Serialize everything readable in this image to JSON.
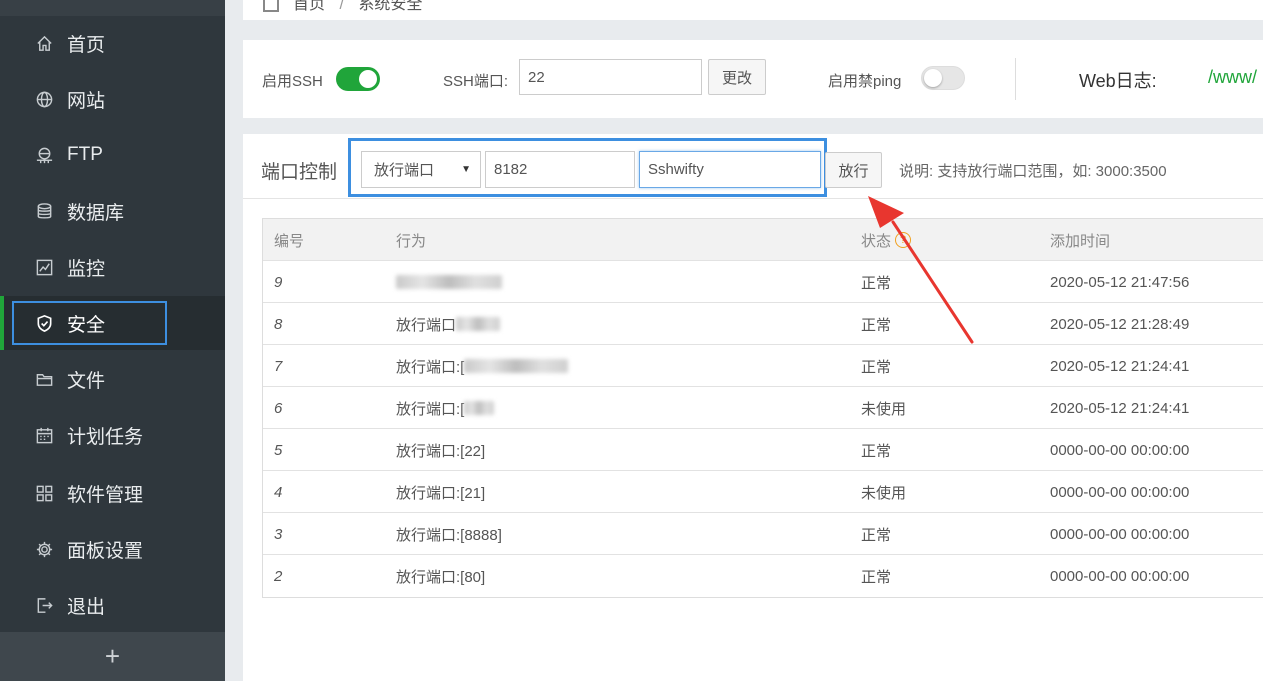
{
  "sidebar": {
    "items": [
      {
        "label": "首页",
        "icon": "home-icon"
      },
      {
        "label": "网站",
        "icon": "globe-icon"
      },
      {
        "label": "FTP",
        "icon": "ftp-icon"
      },
      {
        "label": "数据库",
        "icon": "database-icon"
      },
      {
        "label": "监控",
        "icon": "monitor-chart-icon"
      },
      {
        "label": "安全",
        "icon": "shield-icon",
        "active": true
      },
      {
        "label": "文件",
        "icon": "folder-icon"
      },
      {
        "label": "计划任务",
        "icon": "calendar-icon"
      },
      {
        "label": "软件管理",
        "icon": "apps-grid-icon"
      },
      {
        "label": "面板设置",
        "icon": "gear-icon"
      },
      {
        "label": "退出",
        "icon": "logout-icon"
      }
    ],
    "add_label": "+"
  },
  "breadcrumb": {
    "home": "首页",
    "sep": "/",
    "current": "系统安全"
  },
  "ssh": {
    "enable_label": "启用SSH",
    "enabled": true,
    "port_label": "SSH端口:",
    "port_value": "22",
    "change_button": "更改",
    "ping_label": "启用禁ping",
    "ping_enabled": false,
    "weblog_label": "Web日志:",
    "weblog_path": "/www/"
  },
  "port_control": {
    "title": "端口控制",
    "select_value": "放行端口",
    "port_input": "8182",
    "remark_input": "Sshwifty",
    "submit_button": "放行",
    "note": "说明: 支持放行端口范围，如: 3000:3500"
  },
  "table": {
    "headers": {
      "id": "编号",
      "action": "行为",
      "status": "状态",
      "time": "添加时间"
    },
    "help_icon": "?",
    "rows": [
      {
        "id": "9",
        "action": "",
        "status": "正常",
        "time": "2020-05-12 21:47:56"
      },
      {
        "id": "8",
        "action": "放行端口",
        "status": "正常",
        "time": "2020-05-12 21:28:49"
      },
      {
        "id": "7",
        "action": "放行端口:[",
        "status": "正常",
        "time": "2020-05-12 21:24:41"
      },
      {
        "id": "6",
        "action": "放行端口:[",
        "status": "未使用",
        "time": "2020-05-12 21:24:41"
      },
      {
        "id": "5",
        "action": "放行端口:[22]",
        "status": "正常",
        "time": "0000-00-00 00:00:00"
      },
      {
        "id": "4",
        "action": "放行端口:[21]",
        "status": "未使用",
        "time": "0000-00-00 00:00:00"
      },
      {
        "id": "3",
        "action": "放行端口:[8888]",
        "status": "正常",
        "time": "0000-00-00 00:00:00"
      },
      {
        "id": "2",
        "action": "放行端口:[80]",
        "status": "正常",
        "time": "0000-00-00 00:00:00"
      }
    ]
  },
  "colors": {
    "accent_green": "#20a53a",
    "highlight_blue": "#3d8fe0",
    "arrow_red": "#e8362f"
  }
}
